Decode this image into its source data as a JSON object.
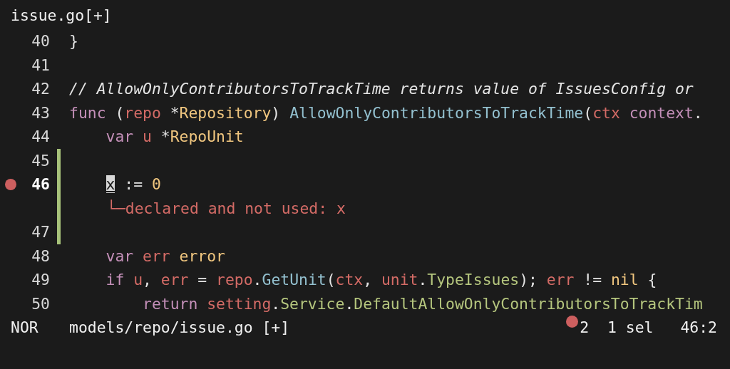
{
  "buffer_title": "issue.go[+]",
  "lines": [
    {
      "kind": "code",
      "number": "40",
      "current": false,
      "modified": false,
      "error": false,
      "tokens": [
        {
          "text": "}",
          "kind": "plain"
        }
      ]
    },
    {
      "kind": "code",
      "number": "41",
      "current": false,
      "modified": false,
      "error": false
    },
    {
      "kind": "code",
      "number": "42",
      "current": false,
      "modified": false,
      "error": false,
      "tokens": [
        {
          "text": "// AllowOnlyContributorsToTrackTime returns value of IssuesConfig or",
          "kind": "comment"
        }
      ]
    },
    {
      "kind": "code",
      "number": "43",
      "current": false,
      "modified": false,
      "error": false,
      "tokens": [
        {
          "text": "func",
          "kind": "keyword"
        },
        {
          "text": " (",
          "kind": "plain"
        },
        {
          "text": "repo",
          "kind": "variable"
        },
        {
          "text": " *",
          "kind": "plain"
        },
        {
          "text": "Repository",
          "kind": "type"
        },
        {
          "text": ") ",
          "kind": "plain"
        },
        {
          "text": "AllowOnlyContributorsToTrackTime",
          "kind": "function"
        },
        {
          "text": "(",
          "kind": "plain"
        },
        {
          "text": "ctx",
          "kind": "variable"
        },
        {
          "text": " context",
          "kind": "keyword"
        },
        {
          "text": ".",
          "kind": "plain"
        }
      ]
    },
    {
      "kind": "code",
      "number": "44",
      "current": false,
      "modified": false,
      "error": false,
      "tokens": [
        {
          "text": "    var",
          "kind": "keyword"
        },
        {
          "text": " u",
          "kind": "variable"
        },
        {
          "text": " *",
          "kind": "plain"
        },
        {
          "text": "RepoUnit",
          "kind": "type"
        }
      ]
    },
    {
      "kind": "code",
      "number": "45",
      "current": false,
      "modified": true,
      "error": false
    },
    {
      "kind": "code",
      "number": "46",
      "current": true,
      "modified": true,
      "error": true,
      "tokens": [
        {
          "text": "    x",
          "kind": "plain",
          "selected": true
        },
        {
          "text": " := ",
          "kind": "plain",
          "selected": false
        },
        {
          "text": "0",
          "kind": "constant"
        }
      ]
    },
    {
      "kind": "diagnostic",
      "text": "└─declared and not used: x",
      "modified": true
    },
    {
      "kind": "code",
      "number": "47",
      "current": false,
      "modified": true,
      "error": false
    },
    {
      "kind": "code",
      "number": "48",
      "current": false,
      "modified": false,
      "error": false,
      "tokens": [
        {
          "text": "    var",
          "kind": "keyword"
        },
        {
          "text": " err",
          "kind": "variable"
        },
        {
          "text": " error",
          "kind": "type"
        }
      ]
    },
    {
      "kind": "code",
      "number": "49",
      "current": false,
      "modified": false,
      "error": false,
      "tokens": [
        {
          "text": "    if",
          "kind": "keyword"
        },
        {
          "text": " u",
          "kind": "variable"
        },
        {
          "text": ", ",
          "kind": "plain"
        },
        {
          "text": "err",
          "kind": "variable"
        },
        {
          "text": " = ",
          "kind": "plain"
        },
        {
          "text": "repo",
          "kind": "variable"
        },
        {
          "text": ".",
          "kind": "plain"
        },
        {
          "text": "GetUnit",
          "kind": "function"
        },
        {
          "text": "(",
          "kind": "plain"
        },
        {
          "text": "ctx",
          "kind": "variable"
        },
        {
          "text": ", ",
          "kind": "plain"
        },
        {
          "text": "unit",
          "kind": "variable"
        },
        {
          "text": ".",
          "kind": "plain"
        },
        {
          "text": "TypeIssues",
          "kind": "member"
        },
        {
          "text": "); ",
          "kind": "plain"
        },
        {
          "text": "err",
          "kind": "variable"
        },
        {
          "text": " != ",
          "kind": "plain"
        },
        {
          "text": "nil",
          "kind": "constant"
        },
        {
          "text": " {",
          "kind": "plain"
        }
      ]
    },
    {
      "kind": "code",
      "number": "50",
      "current": false,
      "modified": false,
      "error": false,
      "tokens": [
        {
          "text": "        return",
          "kind": "keyword"
        },
        {
          "text": " setting",
          "kind": "variable"
        },
        {
          "text": ".",
          "kind": "plain"
        },
        {
          "text": "Service",
          "kind": "member"
        },
        {
          "text": ".",
          "kind": "plain"
        },
        {
          "text": "DefaultAllowOnlyContributorsToTrackTim",
          "kind": "member"
        }
      ]
    }
  ],
  "status_bar": {
    "mode": "NOR",
    "file": "models/repo/issue.go [+]",
    "error_count": "2",
    "selections": "1 sel",
    "position": "46:2"
  }
}
